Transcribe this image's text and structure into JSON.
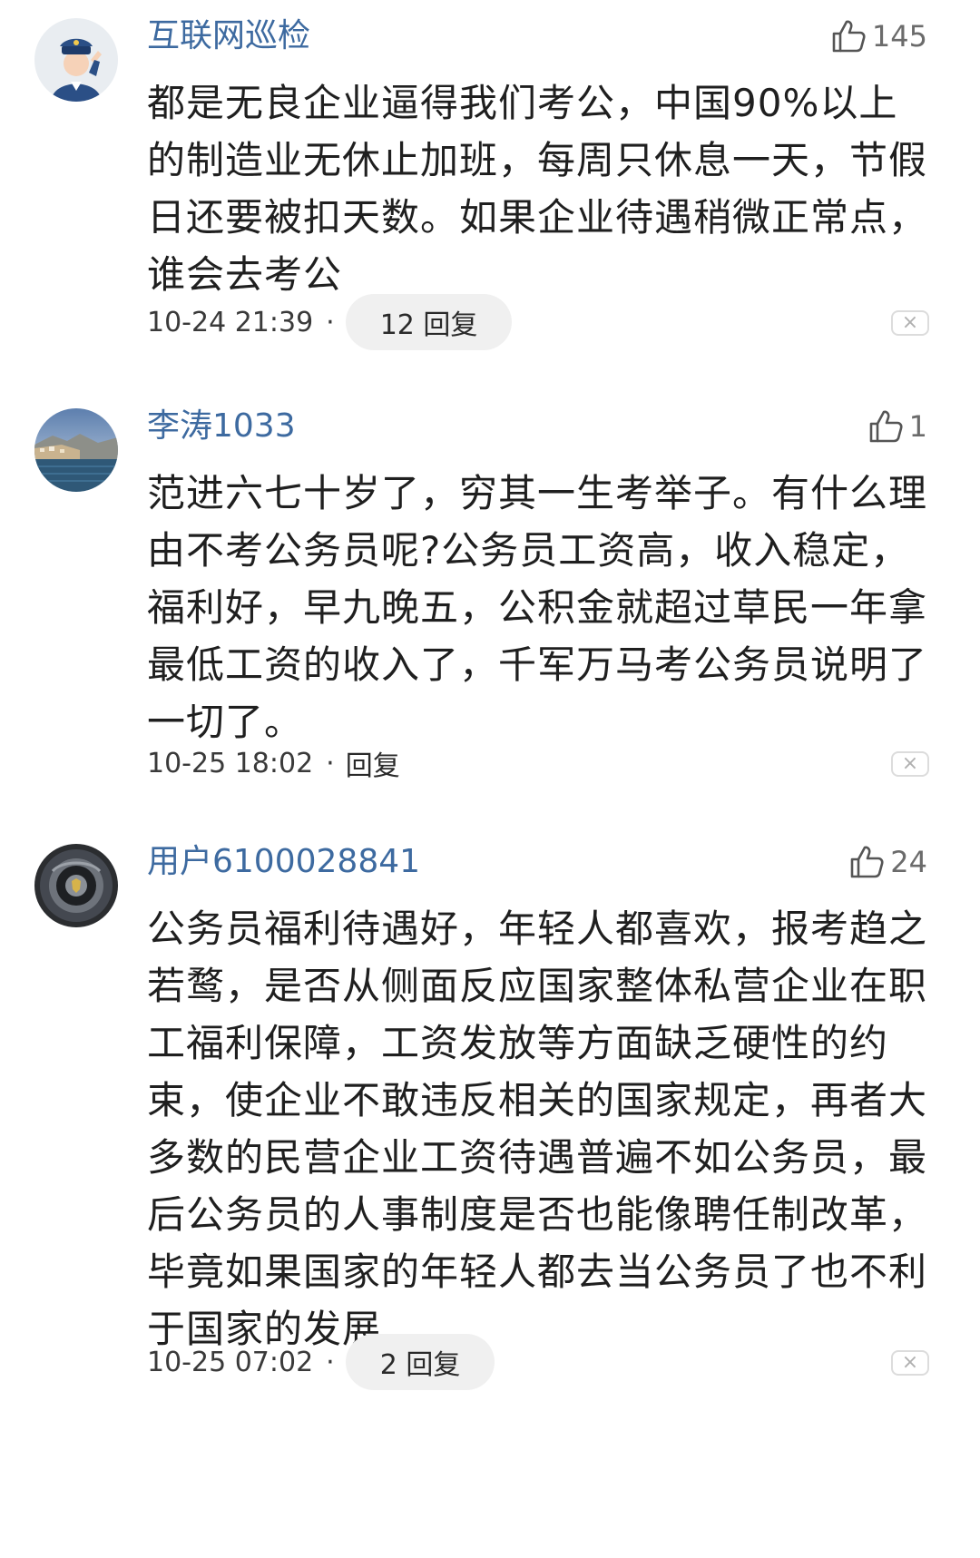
{
  "comments": [
    {
      "username": "互联网巡检",
      "avatar_icon": "police-officer-avatar",
      "likes": "145",
      "text": "都是无良企业逼得我们考公，中国90%以上的制造业无休止加班，每周只休息一天，节假日还要被扣天数。如果企业待遇稍微正常点，谁会去考公",
      "time": "10-24 21:39",
      "separator": "·",
      "reply_label": "12 回复",
      "close_icon": "×"
    },
    {
      "username": "李涛1033",
      "avatar_icon": "coastal-landscape-avatar",
      "likes": "1",
      "text": "范进六七十岁了，穷其一生考举子。有什么理由不考公务员呢?公务员工资高，收入稳定，福利好，早九晚五，公积金就超过草民一年拿最低工资的收入了，千军万马考公务员说明了一切了。",
      "time": "10-25 18:02",
      "separator": "·",
      "reply_label": "回复",
      "close_icon": "×"
    },
    {
      "username": "用户6100028841",
      "avatar_icon": "car-wheel-avatar",
      "likes": "24",
      "text": "公务员福利待遇好，年轻人都喜欢，报考趋之若鹜，是否从侧面反应国家整体私营企业在职工福利保障，工资发放等方面缺乏硬性的约束，使企业不敢违反相关的国家规定，再者大多数的民营企业工资待遇普遍不如公务员，最后公务员的人事制度是否也能像聘任制改革，毕竟如果国家的年轻人都去当公务员了也不利于国家的发展",
      "time": "10-25 07:02",
      "separator": "·",
      "reply_label": "2 回复",
      "close_icon": "×"
    }
  ],
  "colors": {
    "username": "#3d6aa0",
    "text": "#1f1f1f",
    "meta": "#3a3a3a",
    "pill_bg": "#f0f0f0"
  }
}
